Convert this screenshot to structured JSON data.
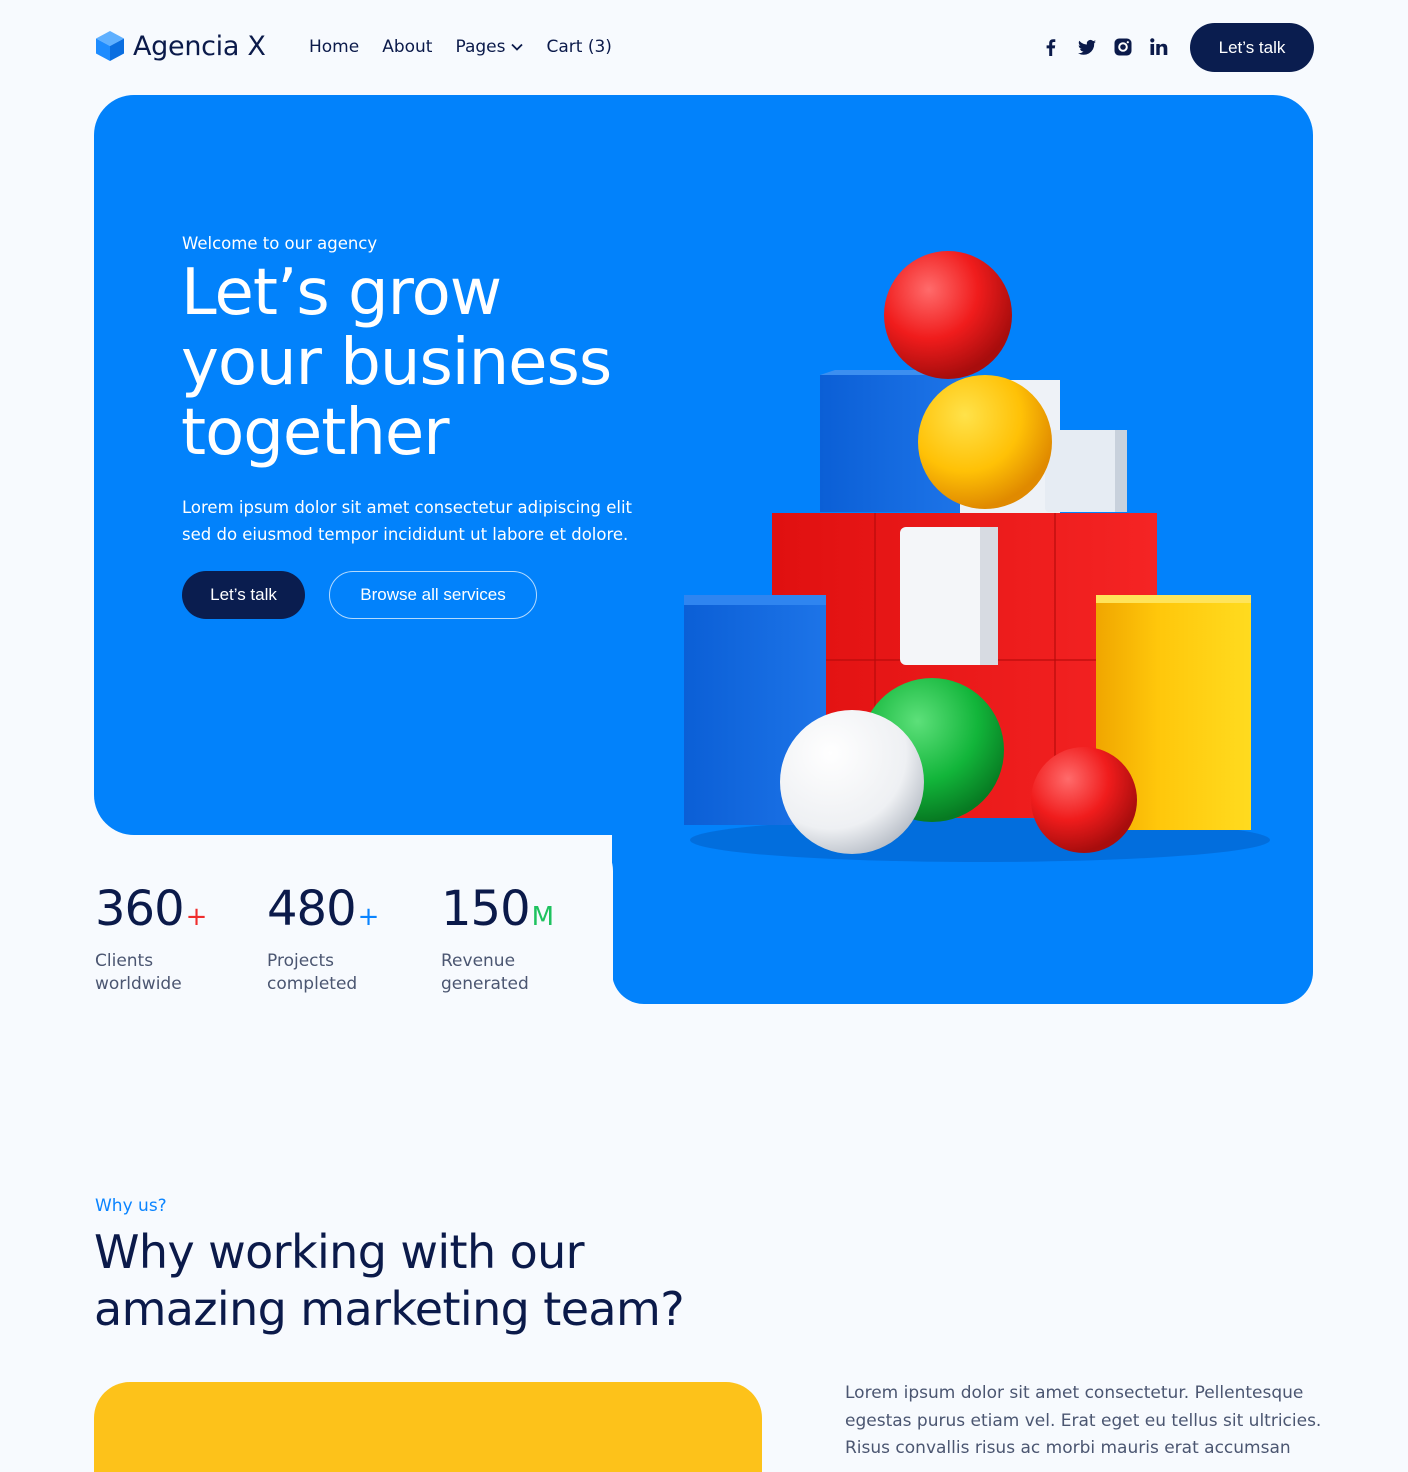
{
  "brand": {
    "name": "Agencia X",
    "accent": "#0282fb",
    "dark": "#0a1d4f"
  },
  "nav": {
    "links": [
      "Home",
      "About",
      "Pages",
      "Cart (3)"
    ],
    "cta_label": "Let’s talk",
    "socials": [
      "facebook-icon",
      "twitter-icon",
      "instagram-icon",
      "linkedin-icon"
    ]
  },
  "hero": {
    "eyebrow": "Welcome to our agency",
    "title_lines": [
      "Let’s grow",
      "your business",
      "together"
    ],
    "text_lines": [
      "Lorem ipsum dolor sit amet consectetur adipiscing elit",
      "sed do eiusmod tempor incididunt ut labore et dolore."
    ],
    "primary_button": "Let’s talk",
    "secondary_button": "Browse all services"
  },
  "stats": [
    {
      "value": "360",
      "suffix": "+",
      "suffix_color": "#ef2d2d",
      "label_lines": [
        "Clients",
        "worldwide"
      ]
    },
    {
      "value": "480",
      "suffix": "+",
      "suffix_color": "#0a84ff",
      "label_lines": [
        "Projects",
        "completed"
      ]
    },
    {
      "value": "150",
      "suffix": "M",
      "suffix_color": "#1ec25f",
      "label_lines": [
        "Revenue",
        "generated"
      ]
    }
  ],
  "why": {
    "eyebrow": "Why us?",
    "title_lines": [
      "Why working with our",
      "amazing marketing team?"
    ],
    "text_lines": [
      "Lorem ipsum dolor sit amet consectetur. Pellentesque",
      "egestas purus etiam vel. Erat eget eu tellus sit ultricies.",
      "Risus convallis risus ac morbi mauris erat accumsan"
    ],
    "card_color": "#fdc21a"
  }
}
